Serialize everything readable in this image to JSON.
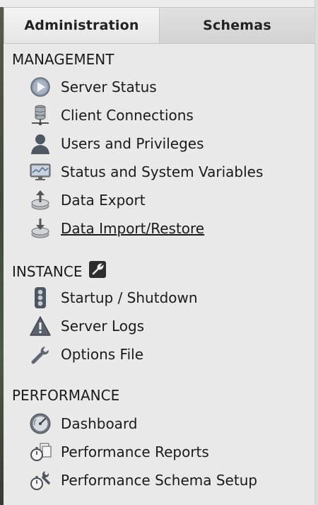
{
  "tabs": [
    {
      "label": "Administration",
      "active": true
    },
    {
      "label": "Schemas",
      "active": false
    }
  ],
  "sections": {
    "management": {
      "title": "MANAGEMENT",
      "items": [
        {
          "label": "Server Status",
          "icon": "play-circle-icon"
        },
        {
          "label": "Client Connections",
          "icon": "database-network-icon"
        },
        {
          "label": "Users and Privileges",
          "icon": "user-silhouette-icon"
        },
        {
          "label": "Status and System Variables",
          "icon": "monitor-graph-icon"
        },
        {
          "label": "Data Export",
          "icon": "export-upload-icon"
        },
        {
          "label": "Data Import/Restore",
          "icon": "import-download-icon"
        }
      ]
    },
    "instance": {
      "title": "INSTANCE",
      "badge_icon": "wrench-badge-icon",
      "items": [
        {
          "label": "Startup / Shutdown",
          "icon": "traffic-light-icon"
        },
        {
          "label": "Server Logs",
          "icon": "warning-triangle-icon"
        },
        {
          "label": "Options File",
          "icon": "wrench-icon"
        }
      ]
    },
    "performance": {
      "title": "PERFORMANCE",
      "items": [
        {
          "label": "Dashboard",
          "icon": "speedometer-icon"
        },
        {
          "label": "Performance Reports",
          "icon": "stopwatch-reports-icon"
        },
        {
          "label": "Performance Schema Setup",
          "icon": "stopwatch-wrench-icon"
        }
      ]
    }
  }
}
